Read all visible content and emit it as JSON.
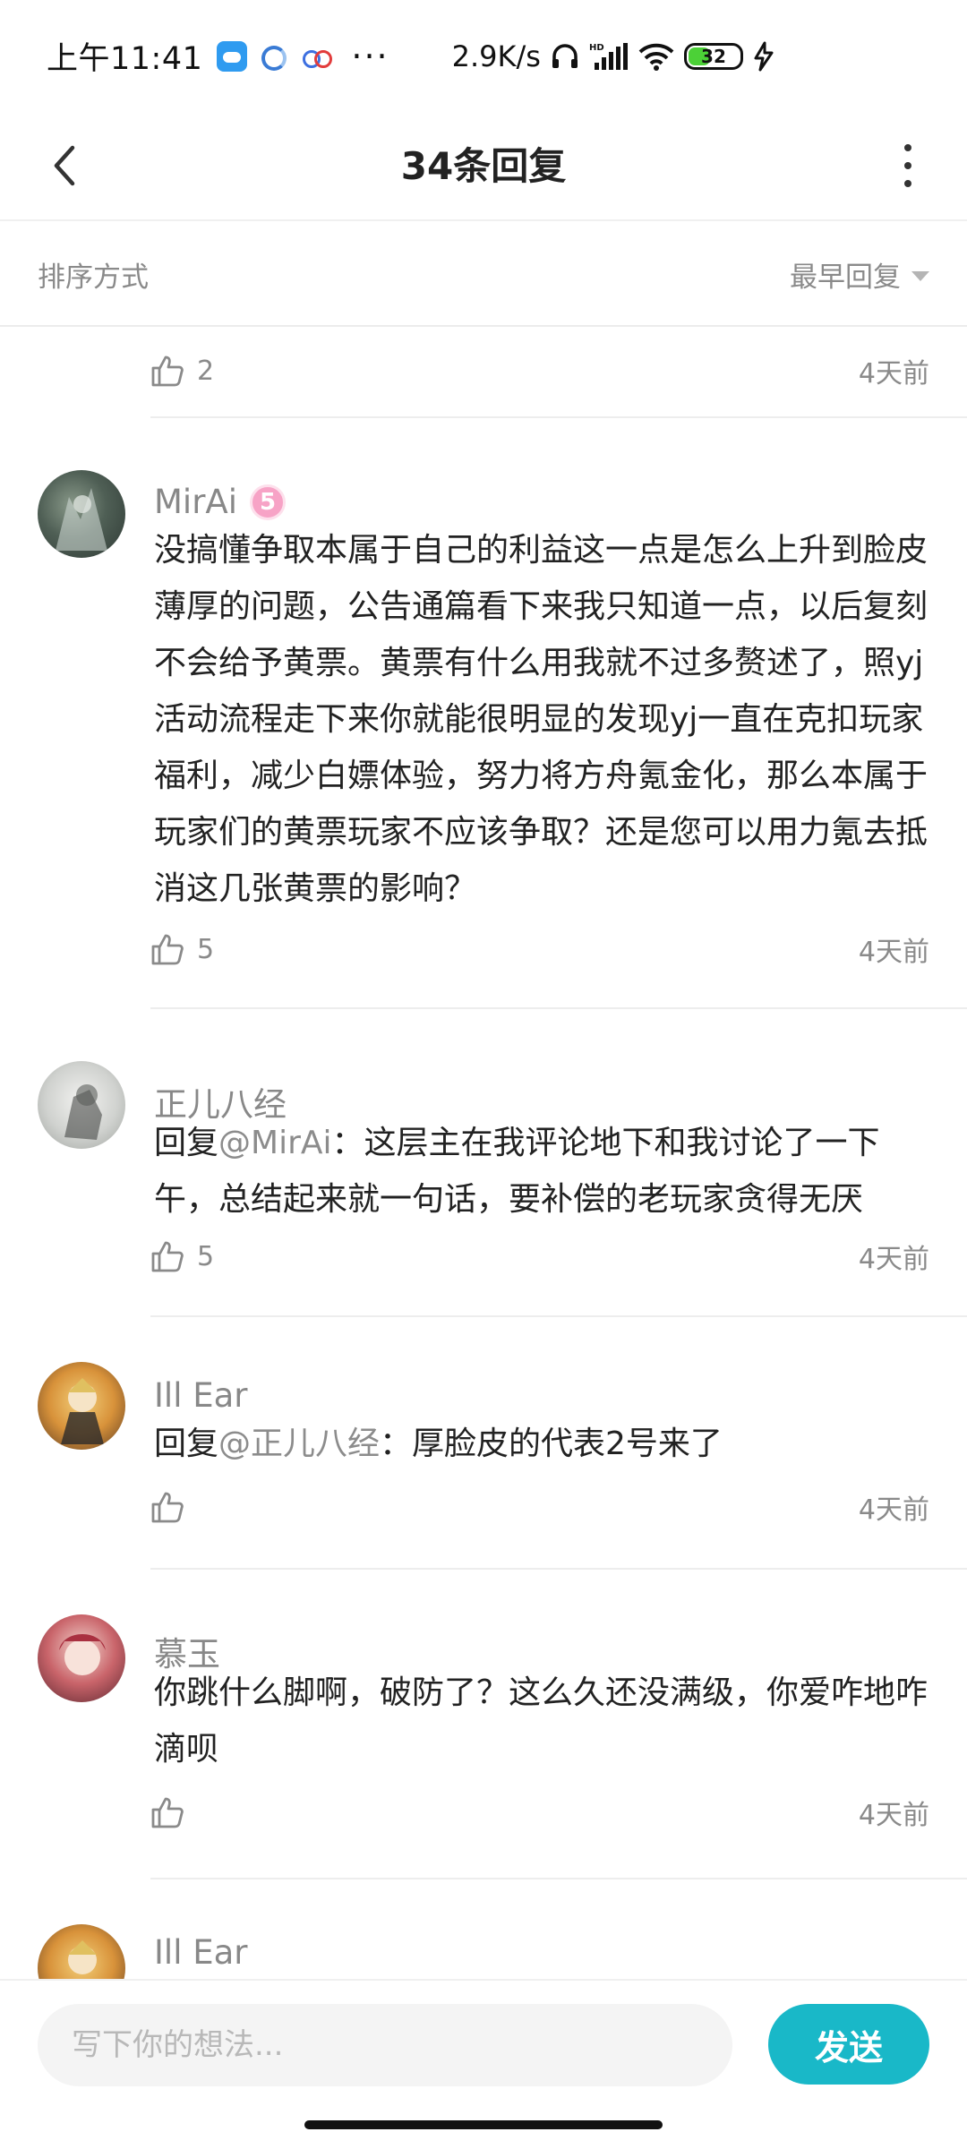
{
  "status_bar": {
    "time": "上午11:41",
    "dots": "···",
    "speed": "2.9K/s",
    "battery": "32"
  },
  "header": {
    "title": "34条回复"
  },
  "sort": {
    "label": "排序方式",
    "selected": "最早回复"
  },
  "top_partial": {
    "likes": "2",
    "time": "4天前"
  },
  "replies": [
    {
      "name": "MirAi",
      "badge": "5",
      "content": "没搞懂争取本属于自己的利益这一点是怎么上升到脸皮薄厚的问题，公告通篇看下来我只知道一点，以后复刻不会给予黄票。黄票有什么用我就不过多赘述了，照yj活动流程走下来你就能很明显的发现yj一直在克扣玩家福利，减少白嫖体验，努力将方舟氪金化，那么本属于玩家们的黄票玩家不应该争取？还是您可以用力氪去抵消这几张黄票的影响？",
      "likes": "5",
      "time": "4天前"
    },
    {
      "name": "正儿八经",
      "reply_prefix": "回复",
      "mention": "@MirAi",
      "content": "：这层主在我评论地下和我讨论了一下午，总结起来就一句话，要补偿的老玩家贪得无厌",
      "likes": "5",
      "time": "4天前"
    },
    {
      "name": "Ill Ear",
      "reply_prefix": "回复",
      "mention": "@正儿八经",
      "content": "：厚脸皮的代表2号来了",
      "likes": "",
      "time": "4天前"
    },
    {
      "name": "慕玉",
      "content": "你跳什么脚啊，破防了？这么久还没满级，你爱咋地咋滴呗",
      "likes": "",
      "time": "4天前"
    },
    {
      "name": "Ill Ear"
    }
  ],
  "composer": {
    "placeholder": "写下你的想法...",
    "send_label": "发送"
  },
  "colors": {
    "accent": "#19b8c8",
    "muted": "#8a8a8a"
  }
}
